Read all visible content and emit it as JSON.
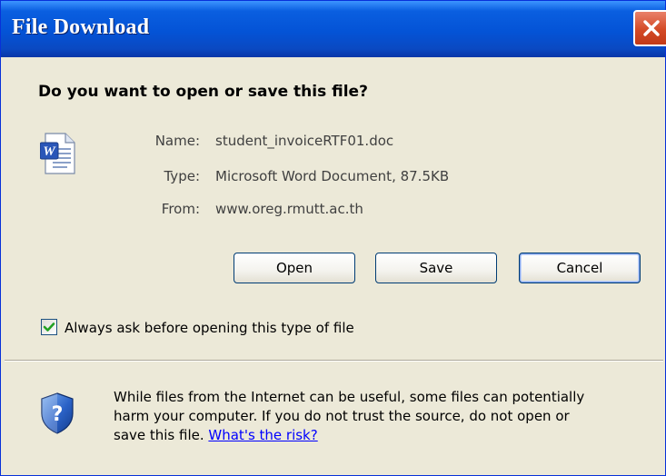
{
  "window": {
    "title": "File Download"
  },
  "dialog": {
    "heading": "Do you want to open or save this file?",
    "file": {
      "name_label": "Name:",
      "name_value": "student_invoiceRTF01.doc",
      "type_label": "Type:",
      "type_value": "Microsoft Word Document, 87.5KB",
      "from_label": "From:",
      "from_value": "www.oreg.rmutt.ac.th"
    },
    "buttons": {
      "open": "Open",
      "save": "Save",
      "cancel": "Cancel"
    },
    "checkbox": {
      "label": "Always ask before opening this type of file",
      "checked": true
    },
    "warning": {
      "line1": "While files from the Internet can be useful, some files can potentially",
      "line2": "harm your computer. If you do not trust the source, do not open or",
      "line3": "save this file. ",
      "link": "What's the risk?"
    }
  },
  "colors": {
    "title_bar": "#0453d6",
    "window_bg": "#ece9d8",
    "close_button": "#d44a26",
    "link": "#0000ff"
  },
  "icons": {
    "file": "word-document-icon",
    "warning": "shield-question-icon",
    "close": "close-icon",
    "check": "checkmark-icon"
  }
}
